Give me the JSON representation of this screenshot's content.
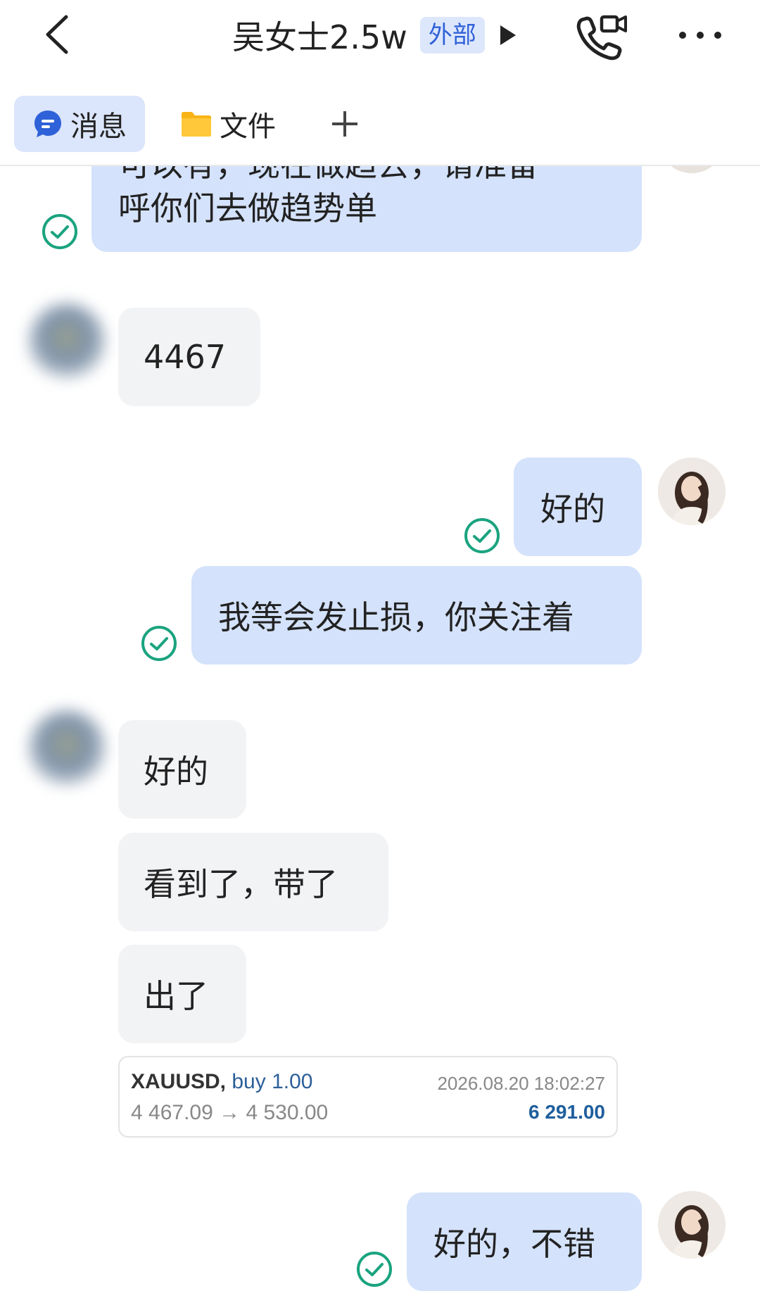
{
  "header": {
    "title": "吴女士2.5w",
    "badge": "外部"
  },
  "tabs": [
    {
      "label": "消息",
      "active": true
    },
    {
      "label": "文件",
      "active": false
    }
  ],
  "messages": {
    "m1_line1": "可以有，现在做趋去，请准备",
    "m1_line2": "呼你们去做趋势单",
    "m2": "4467",
    "m3": "好的",
    "m4": "我等会发止损，你关注着",
    "m5": "好的",
    "m6": "看到了，带了",
    "m7": "出了",
    "m8": "好的，不错"
  },
  "trade": {
    "symbol": "XAUUSD,",
    "side": "buy 1.00",
    "prices": "4 467.09 → 4 530.00",
    "time": "2026.08.20 18:02:27",
    "profit": "6 291.00"
  },
  "colors": {
    "accent": "#2f62d8",
    "bubble_out": "#d4e2fb",
    "bubble_in": "#f2f3f5",
    "check": "#1aa37f"
  }
}
